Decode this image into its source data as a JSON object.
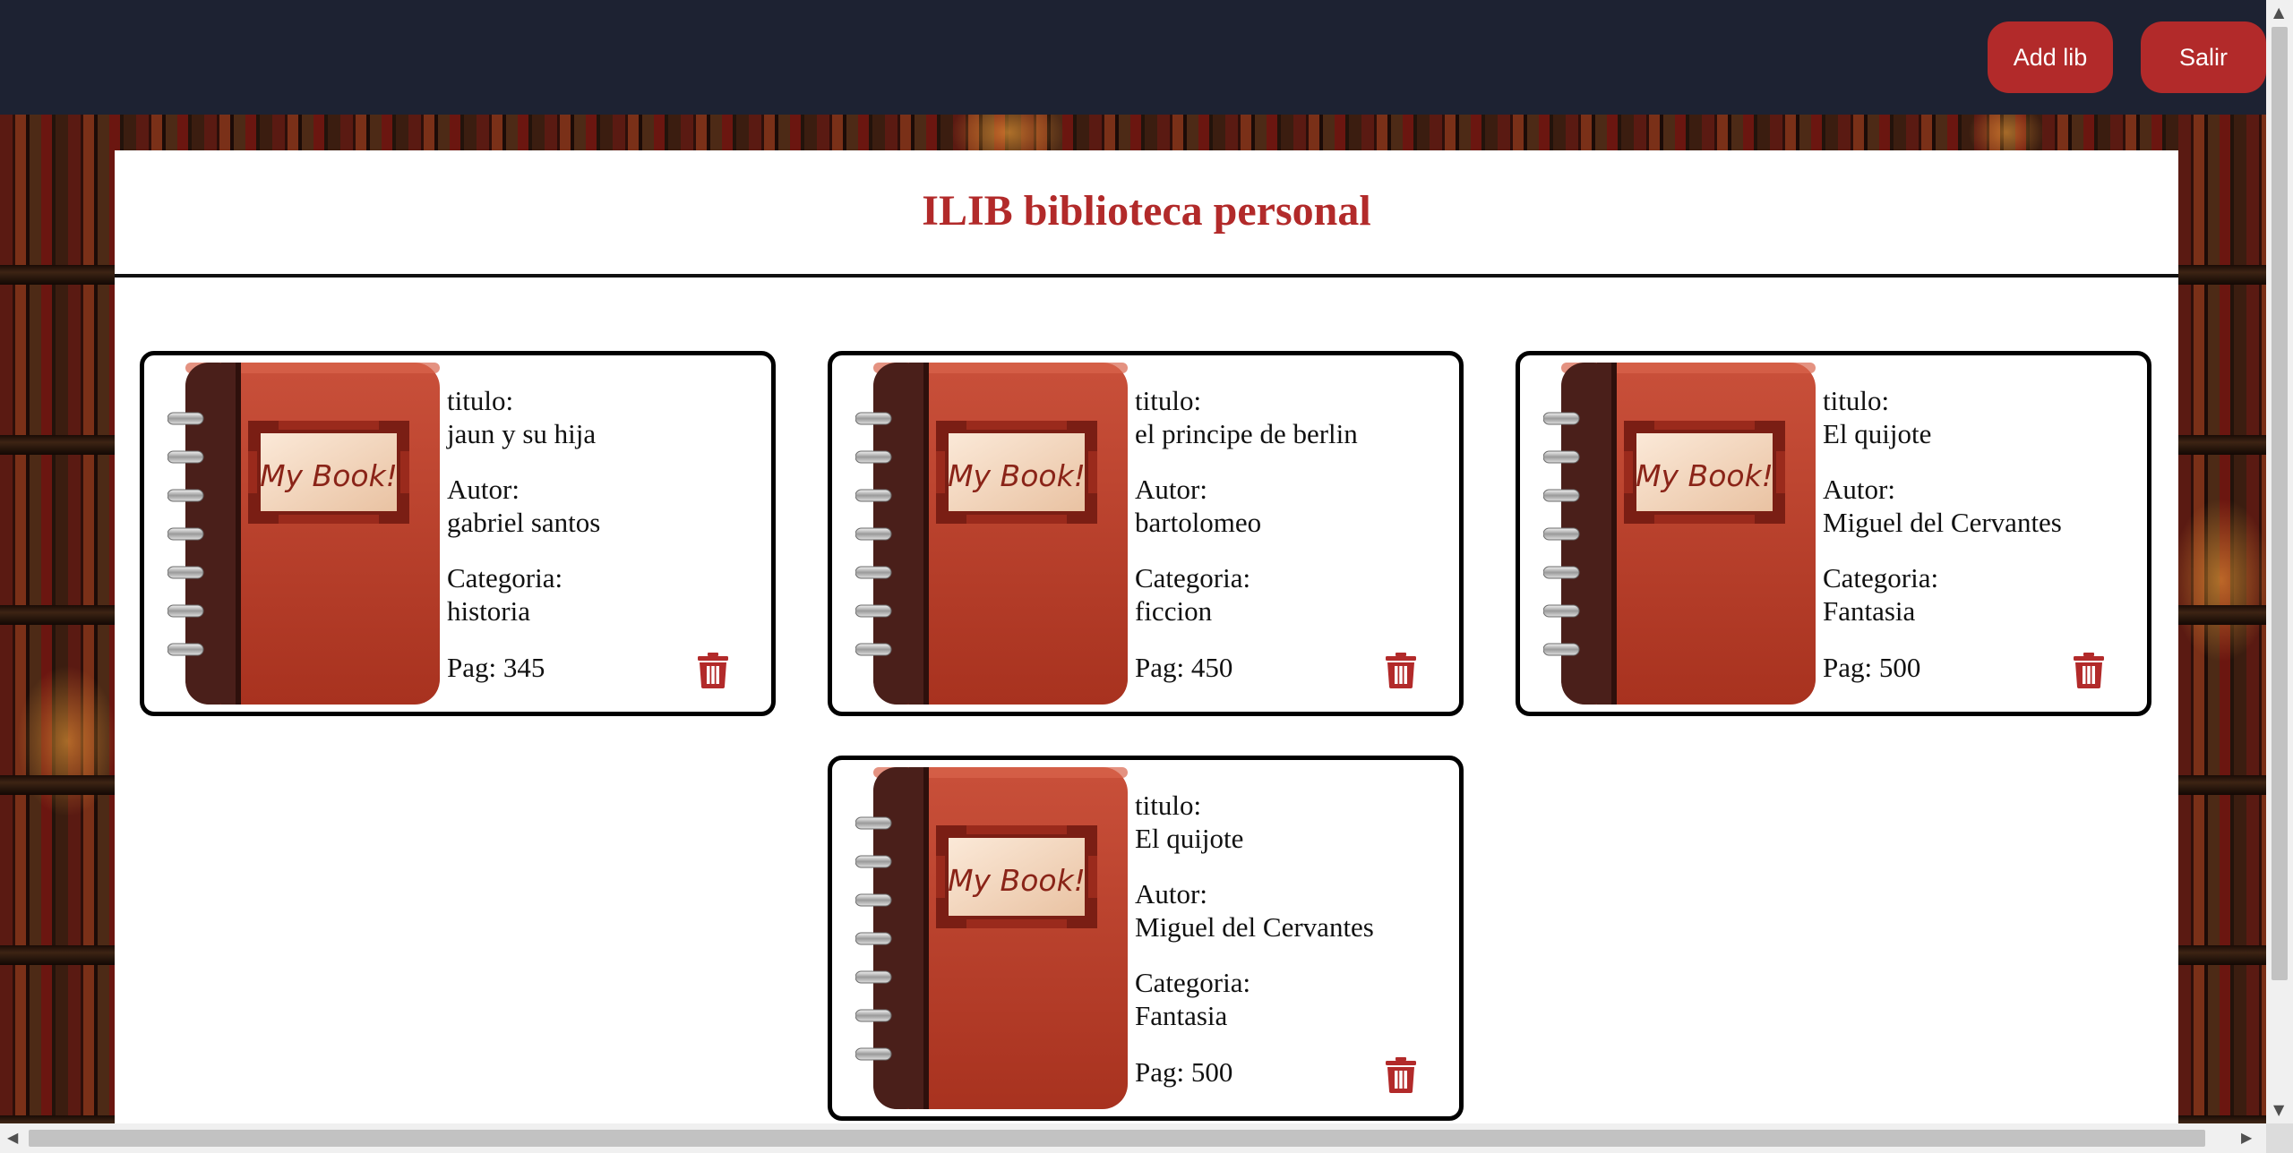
{
  "header": {
    "add_button": "Add lib",
    "exit_button": "Salir"
  },
  "page": {
    "title": "ILIB biblioteca personal"
  },
  "cover_text": "My Book!",
  "books": [
    {
      "titulo_label": "titulo:",
      "titulo": "jaun y su hija",
      "autor_label": "Autor:",
      "autor": "gabriel santos",
      "categoria_label": "Categoria:",
      "categoria": "historia",
      "pag": "Pag: 345"
    },
    {
      "titulo_label": "titulo:",
      "titulo": "el principe de berlin",
      "autor_label": "Autor:",
      "autor": "bartolomeo",
      "categoria_label": "Categoria:",
      "categoria": "ficcion",
      "pag": "Pag: 450"
    },
    {
      "titulo_label": "titulo:",
      "titulo": "El quijote",
      "autor_label": "Autor:",
      "autor": "Miguel del Cervantes",
      "categoria_label": "Categoria:",
      "categoria": "Fantasia",
      "pag": "Pag: 500"
    },
    {
      "titulo_label": "titulo:",
      "titulo": "El quijote",
      "autor_label": "Autor:",
      "autor": "Miguel del Cervantes",
      "categoria_label": "Categoria:",
      "categoria": "Fantasia",
      "pag": "Pag: 500"
    }
  ],
  "colors": {
    "navbar": "#1d2232",
    "accent": "#b22a2a",
    "cover": "#c0432f",
    "spine": "#4a1f1a"
  },
  "icons": {
    "delete": "trash-icon",
    "cover": "notebook-icon"
  }
}
